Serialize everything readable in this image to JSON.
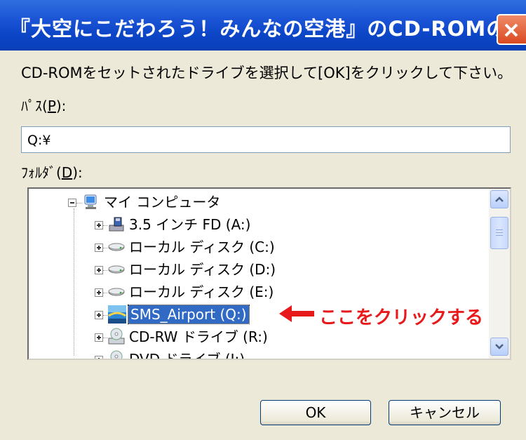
{
  "window": {
    "title": "『大空にこだわろう！みんなの空港』のCD-ROMの確認"
  },
  "instruction": "CD-ROMをセットされたドライブを選択して[OK]をクリックして下さい。",
  "path": {
    "label_prefix": "ﾊﾟｽ(",
    "mnemonic": "P",
    "label_suffix": "):",
    "value": "Q:¥"
  },
  "folder": {
    "label_prefix": "ﾌｫﾙﾀﾞ(",
    "mnemonic": "D",
    "label_suffix": "):"
  },
  "tree": {
    "items": [
      {
        "label": "マイ コンピュータ",
        "icon": "my-computer-icon"
      },
      {
        "label": "3.5 インチ FD (A:)",
        "icon": "floppy-drive-icon"
      },
      {
        "label": "ローカル ディスク (C:)",
        "icon": "hard-disk-icon"
      },
      {
        "label": "ローカル ディスク (D:)",
        "icon": "hard-disk-icon"
      },
      {
        "label": "ローカル ディスク (E:)",
        "icon": "hard-disk-icon"
      },
      {
        "label": "SMS_Airport (Q:)",
        "icon": "airport-cd-icon",
        "selected": true
      },
      {
        "label": "CD-RW ドライブ (R:)",
        "icon": "cd-drive-icon"
      },
      {
        "label": "DVD ドライブ (J:)",
        "icon": "dvd-drive-icon"
      }
    ]
  },
  "annotation": {
    "text": "ここをクリックする",
    "color": "#e8191a"
  },
  "buttons": {
    "ok": "OK",
    "cancel": "キャンセル"
  },
  "colors": {
    "titlebar": "#0b45c6",
    "selection": "#316ac5",
    "dialog_bg": "#ece9d8"
  }
}
